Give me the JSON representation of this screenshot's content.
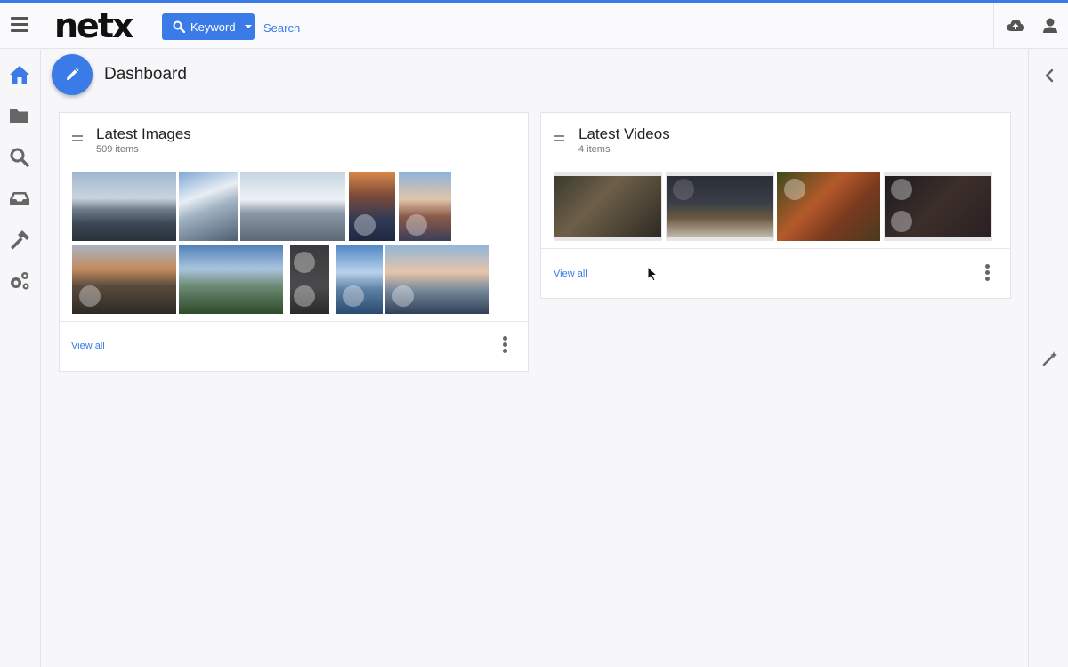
{
  "header": {
    "logo": "netx",
    "keyword_label": "Keyword",
    "search_placeholder": "Search"
  },
  "page": {
    "title": "Dashboard"
  },
  "images_card": {
    "title": "Latest Images",
    "count": "509 items",
    "view_all": "View all"
  },
  "videos_card": {
    "title": "Latest Videos",
    "count": "4 items",
    "view_all": "View all"
  },
  "colors": {
    "accent": "#3a7be8"
  },
  "icons": [
    "hamburger-icon",
    "search-icon",
    "upload-icon",
    "user-icon",
    "home-icon",
    "folder-icon",
    "inbox-icon",
    "hammer-icon",
    "gears-icon",
    "chevron-left-icon",
    "magic-wand-icon",
    "pencil-icon",
    "drag-handle-icon",
    "kebab-icon"
  ]
}
